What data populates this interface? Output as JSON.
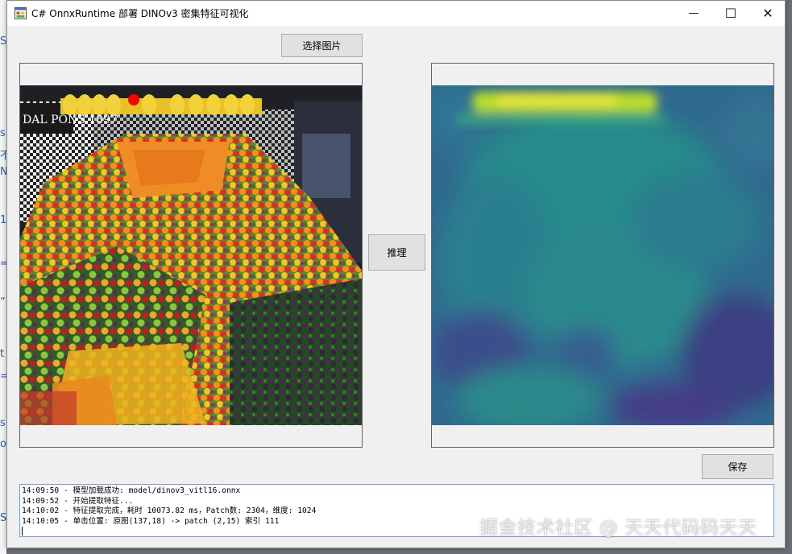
{
  "window": {
    "title": "C# OnnxRuntime 部署 DINOv3 密集特征可视化",
    "minimize_glyph": "—",
    "maximize_glyph": "☐",
    "close_glyph": "✕",
    "icon": "app-window-icon"
  },
  "background_editor_chars": [
    "S",
    "s",
    "不",
    "N",
    "1",
    "=",
    "”",
    "t",
    "=",
    "s",
    "o",
    "S"
  ],
  "buttons": {
    "select_image": "选择图片",
    "infer": "推理",
    "save": "保存"
  },
  "panels": {
    "original_marker_color": "#ff0000",
    "heatmap_palette": [
      "#440154",
      "#3b528b",
      "#21918c",
      "#5ec962",
      "#fde725"
    ]
  },
  "log": {
    "lines": [
      "14:09:50 - 模型加载成功: model/dinov3_vitl16.onnx",
      "14:09:52 - 开始提取特征...",
      "14:10:02 - 特征提取完成，耗时 10073.82 ms，Patch数: 2304，维度: 1024",
      "14:10:05 - 单击位置: 原图(137,18) -> patch (2,15) 索引 111"
    ]
  },
  "watermark": "掘金技术社区 @ 天天代码码天天"
}
